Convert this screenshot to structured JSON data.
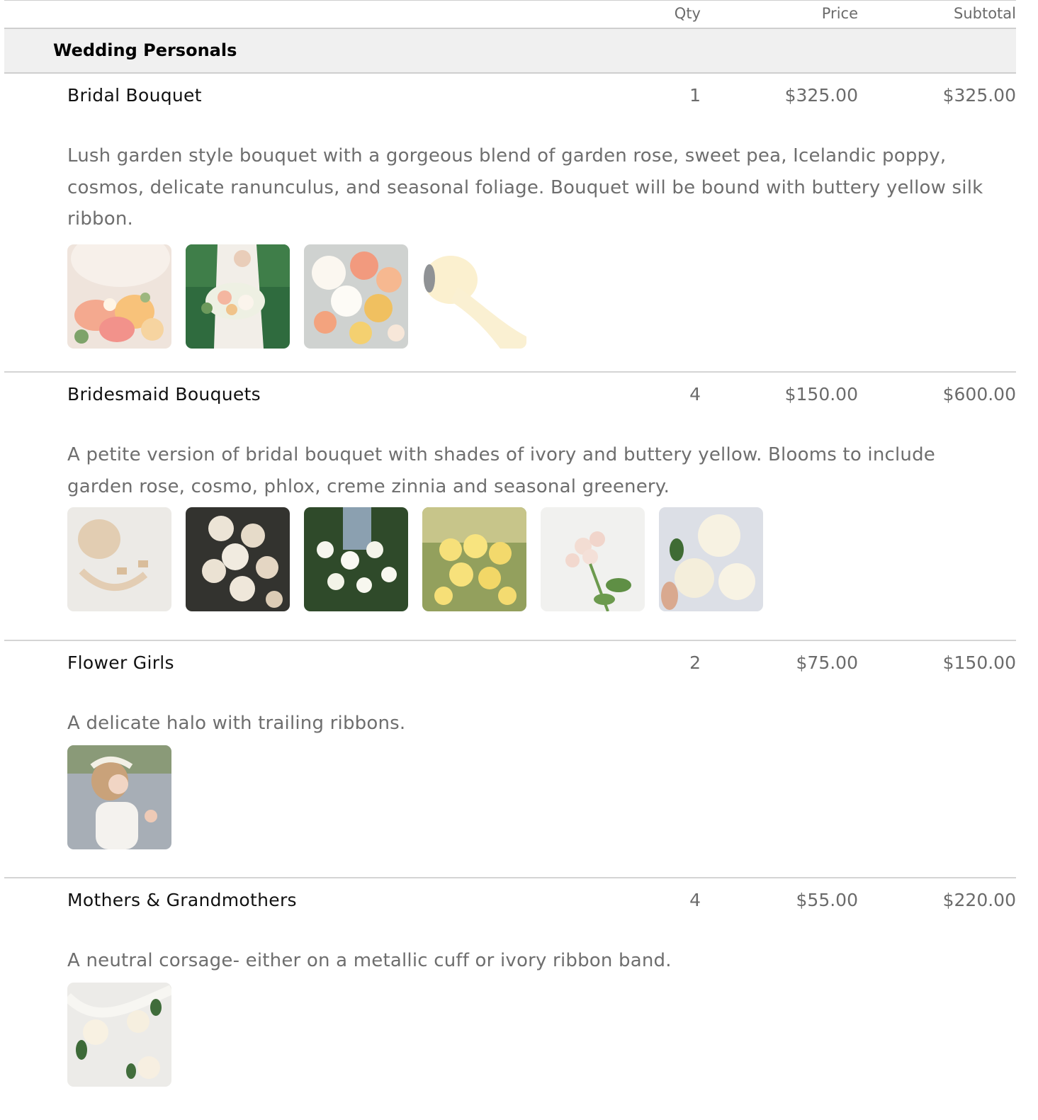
{
  "header": {
    "qty": "Qty",
    "price": "Price",
    "subtotal": "Subtotal"
  },
  "section": {
    "title": "Wedding Personals"
  },
  "items": [
    {
      "name": "Bridal Bouquet",
      "qty": "1",
      "price": "$325.00",
      "subtotal": "$325.00",
      "description": "Lush garden style bouquet with a gorgeous blend of garden rose, sweet pea, Icelandic poppy, cosmos, delicate ranunculus, and seasonal foliage. Bouquet will be bound with buttery yellow silk ribbon.",
      "images": [
        "bride-bouquet-peach-photo",
        "bride-garden-bouquet-photo",
        "peach-rose-bouquet-photo",
        "yellow-silk-ribbon-photo"
      ]
    },
    {
      "name": "Bridesmaid Bouquets",
      "qty": "4",
      "price": "$150.00",
      "subtotal": "$600.00",
      "description": "A petite version of bridal bouquet with shades of ivory and buttery yellow. Blooms to include garden rose, cosmo, phlox, creme zinnia and seasonal greenery.",
      "images": [
        "ivory-ribbon-photo",
        "ivory-roses-photo",
        "white-cosmos-photo",
        "yellow-zinnia-photo",
        "phlox-photo",
        "ivory-garden-rose-photo"
      ]
    },
    {
      "name": "Flower Girls",
      "qty": "2",
      "price": "$75.00",
      "subtotal": "$150.00",
      "description": "A delicate halo with trailing ribbons.",
      "images": [
        "flower-girl-halo-photo"
      ]
    },
    {
      "name": "Mothers & Grandmothers",
      "qty": "4",
      "price": "$55.00",
      "subtotal": "$220.00",
      "description": "A neutral corsage- either on a metallic cuff or ivory ribbon band.",
      "images": [
        "ivory-corsage-photo"
      ]
    }
  ]
}
